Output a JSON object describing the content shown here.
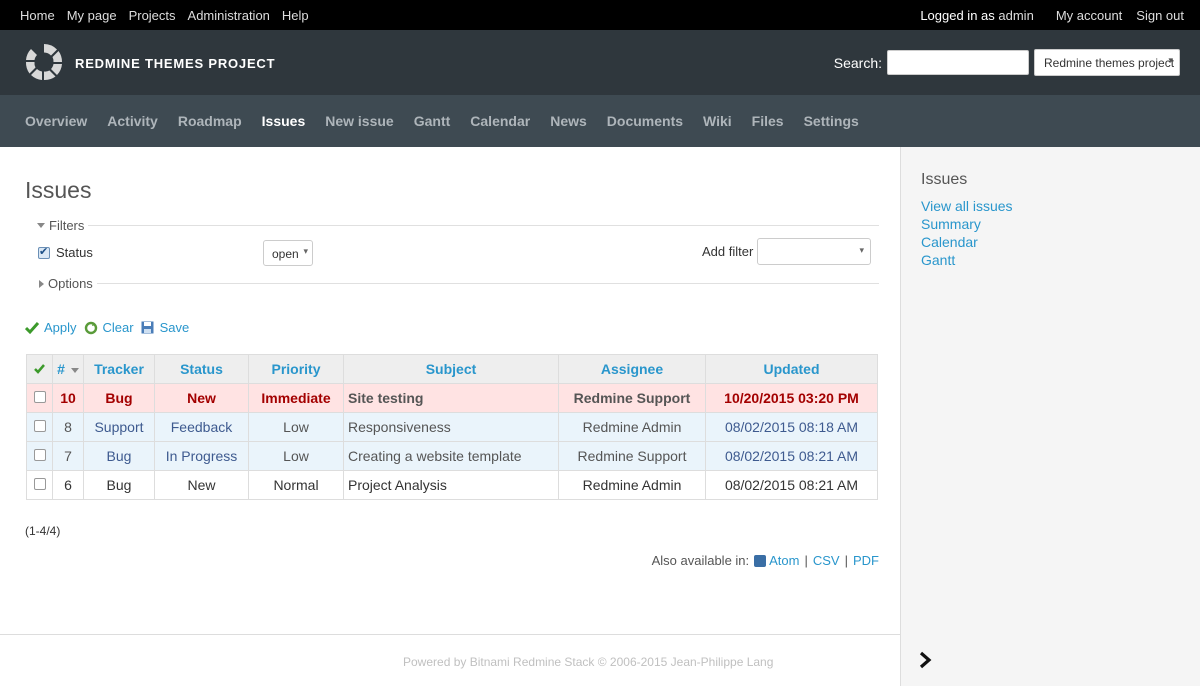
{
  "top_menu": {
    "items": [
      "Home",
      "My page",
      "Projects",
      "Administration",
      "Help"
    ],
    "logged_in_prefix": "Logged in as",
    "user": "admin",
    "my_account": "My account",
    "sign_out": "Sign out"
  },
  "header": {
    "project_title": "REDMINE THEMES PROJECT",
    "search_label": "Search:",
    "search_value": "",
    "project_jump": "Redmine themes project"
  },
  "main_menu": {
    "items": [
      "Overview",
      "Activity",
      "Roadmap",
      "Issues",
      "New issue",
      "Gantt",
      "Calendar",
      "News",
      "Documents",
      "Wiki",
      "Files",
      "Settings"
    ],
    "selected": "Issues"
  },
  "page": {
    "title": "Issues",
    "filters_legend": "Filters",
    "options_legend": "Options",
    "status_filter_label": "Status",
    "status_operator": "open",
    "add_filter_label": "Add filter",
    "apply": "Apply",
    "clear": "Clear",
    "save": "Save",
    "pagination": "(1-4/4)",
    "also_available": "Also available in:",
    "formats": [
      "Atom",
      "CSV",
      "PDF"
    ]
  },
  "table": {
    "headers": [
      "#",
      "Tracker",
      "Status",
      "Priority",
      "Subject",
      "Assignee",
      "Updated"
    ],
    "rows": [
      {
        "id": "10",
        "tracker": "Bug",
        "status": "New",
        "priority": "Immediate",
        "subject": "Site testing",
        "assignee": "Redmine Support",
        "updated": "10/20/2015 03:20 PM"
      },
      {
        "id": "8",
        "tracker": "Support",
        "status": "Feedback",
        "priority": "Low",
        "subject": "Responsiveness",
        "assignee": "Redmine Admin",
        "updated": "08/02/2015 08:18 AM"
      },
      {
        "id": "7",
        "tracker": "Bug",
        "status": "In Progress",
        "priority": "Low",
        "subject": "Creating a website template",
        "assignee": "Redmine Support",
        "updated": "08/02/2015 08:21 AM"
      },
      {
        "id": "6",
        "tracker": "Bug",
        "status": "New",
        "priority": "Normal",
        "subject": "Project Analysis",
        "assignee": "Redmine Admin",
        "updated": "08/02/2015 08:21 AM"
      }
    ]
  },
  "sidebar": {
    "title": "Issues",
    "links": [
      "View all issues",
      "Summary",
      "Calendar",
      "Gantt"
    ]
  },
  "footer": {
    "text": "Powered by Bitnami Redmine Stack © 2006-2015 Jean-Philippe Lang"
  }
}
